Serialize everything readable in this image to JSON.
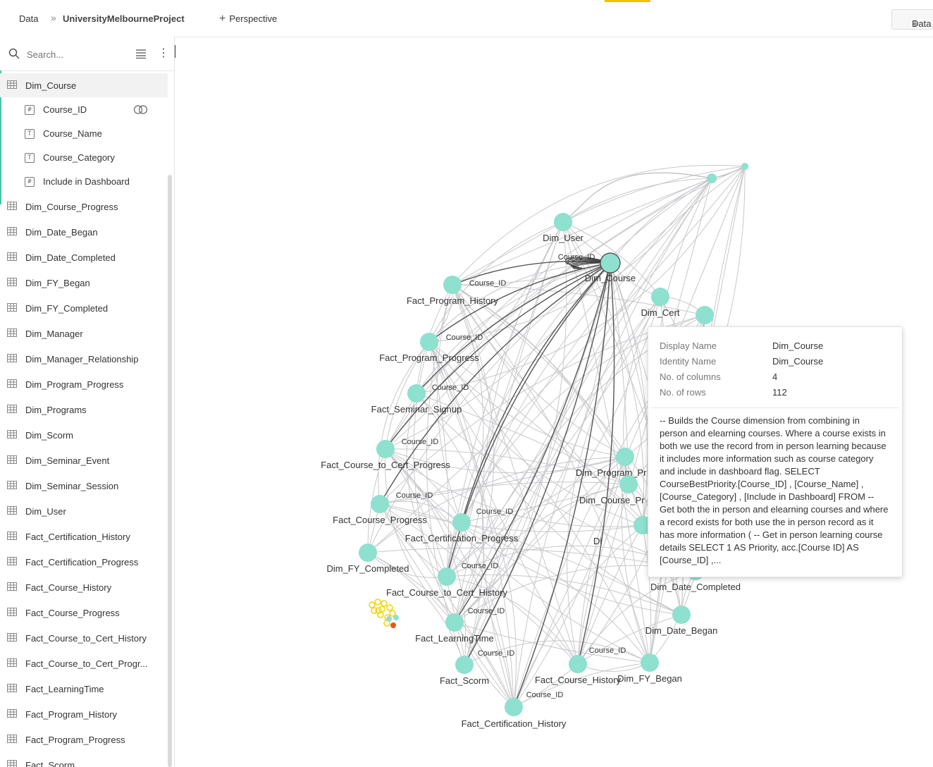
{
  "header": {
    "crumb_data": "Data",
    "crumb_sep": "»",
    "project": "UniversityMelbourneProject",
    "perspective_label": "Perspective",
    "data_button_label": "Data"
  },
  "sidebar": {
    "search_placeholder": "Search...",
    "tables": [
      {
        "label": "Dim_Course",
        "selected": true
      },
      {
        "label": "Dim_Course_Progress"
      },
      {
        "label": "Dim_Date_Began"
      },
      {
        "label": "Dim_Date_Completed"
      },
      {
        "label": "Dim_FY_Began"
      },
      {
        "label": "Dim_FY_Completed"
      },
      {
        "label": "Dim_Manager"
      },
      {
        "label": "Dim_Manager_Relationship"
      },
      {
        "label": "Dim_Program_Progress"
      },
      {
        "label": "Dim_Programs"
      },
      {
        "label": "Dim_Scorm"
      },
      {
        "label": "Dim_Seminar_Event"
      },
      {
        "label": "Dim_Seminar_Session"
      },
      {
        "label": "Dim_User"
      },
      {
        "label": "Fact_Certification_History"
      },
      {
        "label": "Fact_Certification_Progress"
      },
      {
        "label": "Fact_Course_History"
      },
      {
        "label": "Fact_Course_Progress"
      },
      {
        "label": "Fact_Course_to_Cert_History"
      },
      {
        "label": "Fact_Course_to_Cert_Progr..."
      },
      {
        "label": "Fact_LearningTime"
      },
      {
        "label": "Fact_Program_History"
      },
      {
        "label": "Fact_Program_Progress"
      },
      {
        "label": "Fact_Scorm"
      }
    ],
    "columns": [
      {
        "label": "Course_ID",
        "type": "#",
        "linked": true
      },
      {
        "label": "Course_Name",
        "type": "T"
      },
      {
        "label": "Course_Category",
        "type": "T"
      },
      {
        "label": "Include in Dashboard",
        "type": "#"
      }
    ]
  },
  "graph": {
    "edge_label": "Course_ID",
    "node_color": "#8ee0cf",
    "highlight_edge_color": "#555555",
    "bg_edge_color": "#c8c8cc",
    "nodes": [
      {
        "label": "Dim_User"
      },
      {
        "label": "Dim_Course"
      },
      {
        "label": "Dim_Cert"
      },
      {
        "label": "Fact_Program_History"
      },
      {
        "label": "Fact_Program_Progress"
      },
      {
        "label": "Fact_Seminar_Signup"
      },
      {
        "label": "Fact_Course_to_Cert_Progress"
      },
      {
        "label": "Fact_Course_Progress"
      },
      {
        "label": "Dim_FY_Completed"
      },
      {
        "label": "Fact_Certification_Progress"
      },
      {
        "label": "Fact_Course_to_Cert_History"
      },
      {
        "label": "Fact_LearningTime"
      },
      {
        "label": "Fact_Scorm"
      },
      {
        "label": "Fact_Certification_History"
      },
      {
        "label": "Fact_Course_History"
      },
      {
        "label": "Dim_FY_Began"
      },
      {
        "label": "Dim_Date_Began"
      },
      {
        "label": "Dim_Date_Completed"
      },
      {
        "label": "Dim_Program_Pr"
      },
      {
        "label": "Dim_Course_Pr"
      },
      {
        "label": "Di"
      }
    ]
  },
  "tooltip": {
    "rows": [
      {
        "key": "Display Name",
        "value": "Dim_Course"
      },
      {
        "key": "Identity Name",
        "value": "Dim_Course"
      },
      {
        "key": "No. of columns",
        "value": "4"
      },
      {
        "key": "No. of rows",
        "value": "112"
      }
    ],
    "description": "-- Builds the Course dimension from combining in person and elearning courses. Where a course exists in both we use the record from in person learning because it includes more information such as course category and include in dashboard flag. SELECT CourseBestPriority.[Course_ID] , [Course_Name] , [Course_Category] , [Include in Dashboard] FROM -- Get both the in person and elearning courses and where a record exists for both use the in person record as it has more information ( -- Get in person learning course details SELECT 1 AS Priority, acc.[Course ID] AS [Course_ID] ,..."
  }
}
